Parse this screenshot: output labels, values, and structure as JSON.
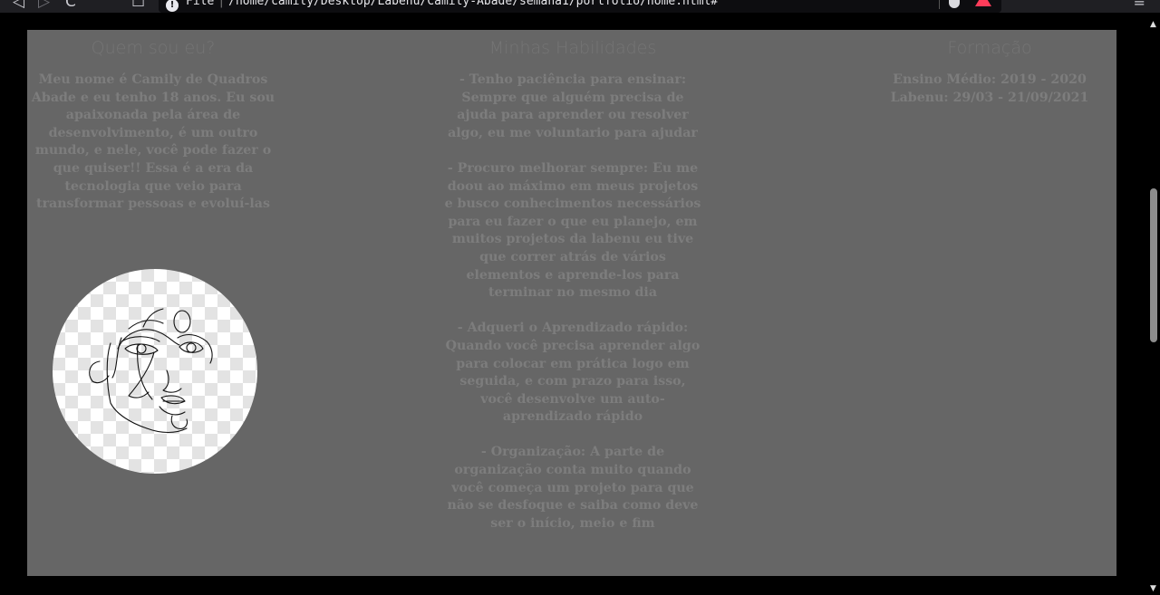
{
  "browser": {
    "url_scheme": "File",
    "url_path": "/home/camily/Desktop/Labenu/Camily-Abade/semana1/portfolio/home.html#",
    "back_glyph": "◁",
    "forward_glyph": "▷",
    "reload_glyph": "C",
    "bookmark_glyph": "☐",
    "info_glyph": "!",
    "menu_glyph": "≡"
  },
  "sections": {
    "about": {
      "title": "Quem sou eu?",
      "text": "Meu nome é Camily de Quadros Abade e eu tenho 18 anos. Eu sou apaixonada pela área de desenvolvimento, é um outro mundo, e nele, você pode fazer o que quiser!! Essa é a era da tecnologia que veio para transformar pessoas e evoluí-las"
    },
    "skills": {
      "title": "Minhas Habilidades",
      "items": [
        "- Tenho paciência para ensinar: Sempre que alguém precisa de ajuda para aprender ou resolver algo, eu me voluntario para ajudar",
        "- Procuro melhorar sempre: Eu me doou ao máximo em meus projetos e busco conhecimentos necessários para eu fazer o que eu planejo, em muitos projetos da labenu eu tive que correr atrás de vários elementos e aprende-los para terminar no mesmo dia",
        "- Adqueri o Aprendizado rápido: Quando você precisa aprender algo para colocar em prática logo em seguida, e com prazo para isso, você desenvolve um auto-aprendizado rápido",
        "- Organização: A parte de organização conta muito quando você começa um projeto para que não se desfoque e saiba como deve ser o início, meio e fim"
      ]
    },
    "education": {
      "title": "Formação",
      "items": [
        "Ensino Médio: 2019 - 2020",
        "Labenu: 29/03 - 21/09/2021"
      ]
    }
  }
}
